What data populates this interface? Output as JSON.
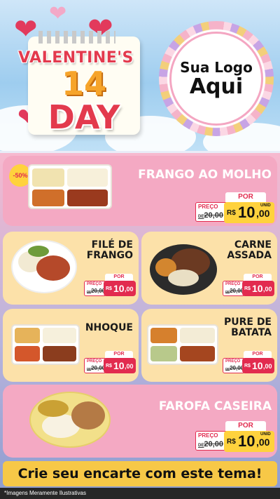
{
  "header": {
    "title_line1": "VALENTINE'S",
    "title_number": "14",
    "title_line3": "DAY",
    "logo_line1": "Sua Logo",
    "logo_line2": "Aqui"
  },
  "products": [
    {
      "name": "FRANGO AO MOLHO",
      "badge": "-50%",
      "por_label": "POR",
      "preco_label": "PREÇO",
      "old_prefix": "DE",
      "old_price": "20,00",
      "currency": "R$",
      "price_int": "10",
      "price_dec": ",00",
      "unit": "UNID"
    },
    {
      "name": "FILÉ DE FRANGO",
      "por_label": "POR",
      "preco_label": "PREÇO",
      "old_prefix": "DE",
      "old_price": "20,00",
      "currency": "R$",
      "price_int": "10",
      "price_dec": ",00",
      "unit": "UNID"
    },
    {
      "name": "CARNE ASSADA",
      "por_label": "POR",
      "preco_label": "PREÇO",
      "old_prefix": "DE",
      "old_price": "20,00",
      "currency": "R$",
      "price_int": "10",
      "price_dec": ",00",
      "unit": "UNID"
    },
    {
      "name": "NHOQUE",
      "por_label": "POR",
      "preco_label": "PREÇO",
      "old_prefix": "DE",
      "old_price": "20,00",
      "currency": "R$",
      "price_int": "10",
      "price_dec": ",00",
      "unit": "UNID"
    },
    {
      "name": "PURE DE BATATA",
      "por_label": "POR",
      "preco_label": "PREÇO",
      "old_prefix": "DE",
      "old_price": "20,00",
      "currency": "R$",
      "price_int": "10",
      "price_dec": ",00",
      "unit": "UNID"
    },
    {
      "name": "FAROFA CASEIRA",
      "por_label": "POR",
      "preco_label": "PREÇO",
      "old_prefix": "DE",
      "old_price": "20,00",
      "currency": "R$",
      "price_int": "10",
      "price_dec": ",00",
      "unit": "UNID"
    }
  ],
  "cta": "Crie seu encarte com este tema!",
  "footer": "*Imagens Meramente Ilustrativas",
  "colors": {
    "pink_card": "#f4a9c3",
    "cream_card": "#fce1a9",
    "price_red": "#e22b4f",
    "gold": "#ffd23d",
    "cta_yellow": "#f7c847"
  }
}
